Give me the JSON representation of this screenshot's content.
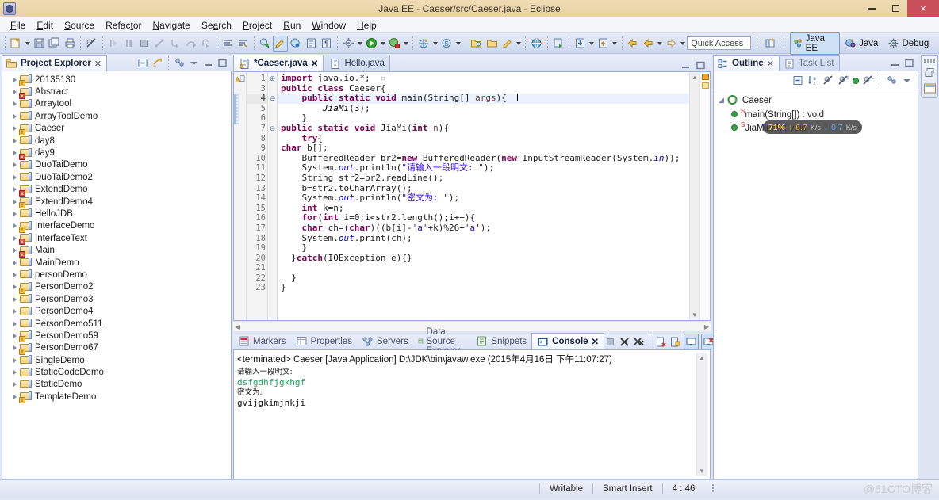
{
  "window": {
    "title": "Java EE - Caeser/src/Caeser.java - Eclipse",
    "app_icon": "eclipse-icon",
    "minimize": "minimize-icon",
    "maximize": "restore-icon",
    "close": "×"
  },
  "menubar": [
    {
      "label": "File",
      "accel": "F"
    },
    {
      "label": "Edit",
      "accel": "E"
    },
    {
      "label": "Source",
      "accel": "S"
    },
    {
      "label": "Refactor",
      "accel": "t"
    },
    {
      "label": "Navigate",
      "accel": "N"
    },
    {
      "label": "Search",
      "accel": "a"
    },
    {
      "label": "Project",
      "accel": "P"
    },
    {
      "label": "Run",
      "accel": "R"
    },
    {
      "label": "Window",
      "accel": "W"
    },
    {
      "label": "Help",
      "accel": "H"
    }
  ],
  "toolbar": {
    "quick_access_placeholder": "Quick Access",
    "perspectives": [
      {
        "label": "Java EE",
        "active": true
      },
      {
        "label": "Java",
        "active": false
      },
      {
        "label": "Debug",
        "active": false
      }
    ],
    "open_perspective_icon": "open-perspective-icon"
  },
  "explorer": {
    "tab_label": "Project Explorer",
    "close_glyph": "✕",
    "tools": [
      "collapse-all-icon",
      "link-with-editor-icon",
      "view-menu-icon",
      "minimize-icon",
      "maximize-icon"
    ],
    "items": [
      {
        "label": "20135130",
        "badge": "warn"
      },
      {
        "label": "Abstract",
        "badge": "err"
      },
      {
        "label": "Arraytool",
        "badge": "none"
      },
      {
        "label": "ArrayToolDemo",
        "badge": "none"
      },
      {
        "label": "Caeser",
        "badge": "warn"
      },
      {
        "label": "day8",
        "badge": "none"
      },
      {
        "label": "day9",
        "badge": "err"
      },
      {
        "label": "DuoTaiDemo",
        "badge": "none"
      },
      {
        "label": "DuoTaiDemo2",
        "badge": "none"
      },
      {
        "label": "ExtendDemo",
        "badge": "err"
      },
      {
        "label": "ExtendDemo4",
        "badge": "warn"
      },
      {
        "label": "HelloJDB",
        "badge": "none"
      },
      {
        "label": "InterfaceDemo",
        "badge": "warn"
      },
      {
        "label": "InterfaceText",
        "badge": "err"
      },
      {
        "label": "Main",
        "badge": "err"
      },
      {
        "label": "MainDemo",
        "badge": "none"
      },
      {
        "label": "personDemo",
        "badge": "none"
      },
      {
        "label": "PersonDemo2",
        "badge": "warn"
      },
      {
        "label": "PersonDemo3",
        "badge": "none"
      },
      {
        "label": "PersonDemo4",
        "badge": "none"
      },
      {
        "label": "PersonDemo511",
        "badge": "none"
      },
      {
        "label": "PersonDemo59",
        "badge": "warn"
      },
      {
        "label": "PersonDemo67",
        "badge": "warn"
      },
      {
        "label": "SingleDemo",
        "badge": "none"
      },
      {
        "label": "StaticCodeDemo",
        "badge": "none"
      },
      {
        "label": "StaticDemo",
        "badge": "none"
      },
      {
        "label": "TemplateDemo",
        "badge": "warn"
      }
    ]
  },
  "editor": {
    "tabs": [
      {
        "label": "*Caeser.java",
        "active": true,
        "close_glyph": "✕",
        "icon": "java-file-warning-icon"
      },
      {
        "label": "Hello.java",
        "active": false,
        "close_glyph": "",
        "icon": "java-file-icon"
      }
    ],
    "tools": [
      "minimize-icon",
      "maximize-icon"
    ],
    "lines": [
      {
        "num": "1",
        "fold": "⊕",
        "current": false,
        "html": "<span class=\"kw\">import</span> java.io.*;  <span style=\"color:#b0b0b0\">▫</span>"
      },
      {
        "num": "3",
        "fold": "",
        "current": false,
        "html": "<span class=\"kw\">public</span> <span class=\"kw\">class</span> Caeser{"
      },
      {
        "num": "4",
        "fold": "⊖",
        "current": true,
        "html": "    <span class=\"kw\">public</span> <span class=\"kw\">static</span> <span class=\"kw\">void</span> main(String[] <span class=\"param\">args</span>){  <span class=\"caret\"></span>"
      },
      {
        "num": "5",
        "fold": "",
        "current": false,
        "html": "        <span class=\"mth\">JiaMi</span>(3);"
      },
      {
        "num": "6",
        "fold": "",
        "current": false,
        "html": "    }"
      },
      {
        "num": "7",
        "fold": "⊖",
        "current": false,
        "html": "<span class=\"kw\">public</span> <span class=\"kw\">static</span> <span class=\"kw\">void</span> JiaMi(<span class=\"kw\">int</span> <span class=\"param\">n</span>){"
      },
      {
        "num": "8",
        "fold": "",
        "current": false,
        "html": "    <span class=\"kw\">try</span>{"
      },
      {
        "num": "9",
        "fold": "",
        "current": false,
        "html": "<span class=\"kw\">char</span> b[];"
      },
      {
        "num": "10",
        "fold": "",
        "current": false,
        "html": "    BufferedReader br2=<span class=\"kw\">new</span> BufferedReader(<span class=\"kw\">new</span> InputStreamReader(System.<span class=\"stat\">in</span>));"
      },
      {
        "num": "11",
        "fold": "",
        "current": false,
        "html": "    System.<span class=\"stat\">out</span>.println(<span class=\"str\">\"请输入一段明文: \"</span>);"
      },
      {
        "num": "12",
        "fold": "",
        "current": false,
        "html": "    String str2=br2.readLine();"
      },
      {
        "num": "13",
        "fold": "",
        "current": false,
        "html": "    b=str2.toCharArray();"
      },
      {
        "num": "14",
        "fold": "",
        "current": false,
        "html": "    System.<span class=\"stat\">out</span>.println(<span class=\"str\">\"密文为: \"</span>);"
      },
      {
        "num": "15",
        "fold": "",
        "current": false,
        "html": "    <span class=\"kw\">int</span> k=n;"
      },
      {
        "num": "16",
        "fold": "",
        "current": false,
        "html": "    <span class=\"kw\">for</span>(<span class=\"kw\">int</span> i=0;i&lt;str2.length();i++){"
      },
      {
        "num": "17",
        "fold": "",
        "current": false,
        "html": "    <span class=\"kw\">char</span> ch=(<span class=\"kw\">char</span>)((b[i]-<span class=\"str\">'a'</span>+k)%26+<span class=\"str\">'a'</span>);"
      },
      {
        "num": "18",
        "fold": "",
        "current": false,
        "html": "    System.<span class=\"stat\">out</span>.print(ch);"
      },
      {
        "num": "19",
        "fold": "",
        "current": false,
        "html": "    }"
      },
      {
        "num": "20",
        "fold": "",
        "current": false,
        "html": "  }<span class=\"kw\">catch</span>(IOException e){}"
      },
      {
        "num": "21",
        "fold": "",
        "current": false,
        "html": ""
      },
      {
        "num": "22",
        "fold": "",
        "current": false,
        "html": "  }"
      },
      {
        "num": "23",
        "fold": "",
        "current": false,
        "html": "}"
      }
    ]
  },
  "console": {
    "tabs": [
      {
        "label": "Markers",
        "active": false,
        "icon": "markers-icon"
      },
      {
        "label": "Properties",
        "active": false,
        "icon": "properties-icon"
      },
      {
        "label": "Servers",
        "active": false,
        "icon": "servers-icon"
      },
      {
        "label": "Data Source Explorer",
        "active": false,
        "icon": "data-source-icon"
      },
      {
        "label": "Snippets",
        "active": false,
        "icon": "snippets-icon"
      },
      {
        "label": "Console",
        "active": true,
        "icon": "console-icon"
      }
    ],
    "close_glyph": "✕",
    "terminated_line": "<terminated> Caeser [Java Application] D:\\JDK\\bin\\javaw.exe (2015年4月16日 下午11:07:27)",
    "output": [
      {
        "text": "请输入一段明文:",
        "style": "cjk"
      },
      {
        "text": "dsfgdhfjgkhgf",
        "style": "green"
      },
      {
        "text": "密文为:",
        "style": "cjk"
      },
      {
        "text": "gvijgkimjnkji",
        "style": "plain"
      }
    ],
    "tools": [
      "terminate-icon",
      "remove-launch-icon",
      "remove-all-icon",
      "clear-console-icon",
      "scroll-lock-icon",
      "show-console-icon",
      "pin-console-icon",
      "display-selected-icon",
      "open-console-icon",
      "new-console-icon",
      "minimize-icon",
      "maximize-icon"
    ]
  },
  "outline": {
    "tabs": [
      {
        "label": "Outline",
        "active": true,
        "icon": "outline-icon",
        "close_glyph": "✕"
      },
      {
        "label": "Task List",
        "active": false,
        "icon": "task-list-icon",
        "close_glyph": ""
      }
    ],
    "tools": [
      "collapse-all-icon",
      "sort-icon",
      "hide-fields-icon",
      "hide-static-icon",
      "hide-nonpublic-icon",
      "hide-local-icon",
      "link-icon",
      "view-menu-icon"
    ],
    "panel_tools": [
      "minimize-icon",
      "maximize-icon"
    ],
    "root": "Caeser",
    "members": [
      {
        "label": "main(String[]) : void",
        "modifier": "S"
      },
      {
        "label": "JiaMi(int) : void",
        "modifier": "S"
      }
    ],
    "net_overlay": {
      "percent": "71%",
      "up_arrow": "↑",
      "up": "6.7",
      "up_unit": "K/s",
      "down_arrow": "↓",
      "down": "0.7",
      "down_unit": "K/s"
    }
  },
  "fastview": {
    "icons": [
      "restore-view-icon",
      "editor-area-icon"
    ]
  },
  "statusbar": {
    "writable": "Writable",
    "insert_mode": "Smart Insert",
    "position": "4 : 46",
    "watermark": "@51CTO博客"
  }
}
